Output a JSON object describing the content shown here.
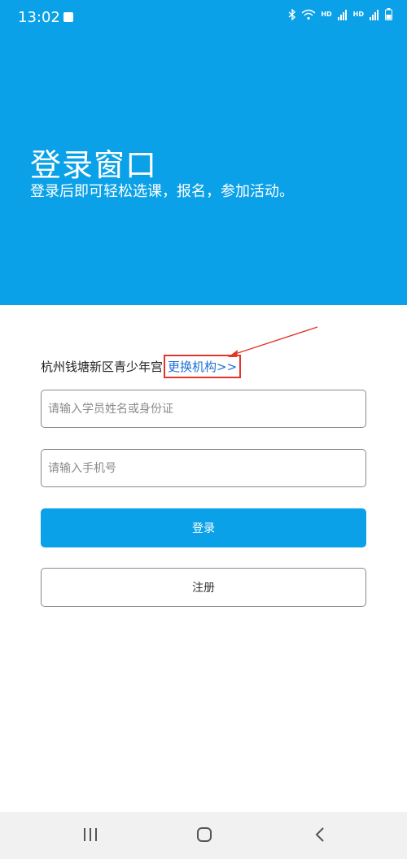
{
  "status_bar": {
    "time": "13:02",
    "hd_label_1": "HD",
    "hd_label_2": "HD",
    "icons": [
      "check-icon",
      "bluetooth-icon",
      "wifi-icon",
      "signal-4g-icon",
      "signal-4g-icon",
      "battery-icon"
    ]
  },
  "header": {
    "title": "登录窗口",
    "subtitle": "登录后即可轻松选课，报名，参加活动。"
  },
  "institution": {
    "name": "杭州钱塘新区青少年宫",
    "change_link": "更换机构>>"
  },
  "form": {
    "name_placeholder": "请输入学员姓名或身份证",
    "phone_placeholder": "请输入手机号",
    "login_label": "登录",
    "register_label": "注册"
  },
  "colors": {
    "primary": "#0aa1e8",
    "annotation": "#e2362c",
    "link": "#1f6fd6"
  },
  "nav_bar": {
    "icons": [
      "recent-apps-icon",
      "home-icon",
      "back-icon"
    ]
  }
}
